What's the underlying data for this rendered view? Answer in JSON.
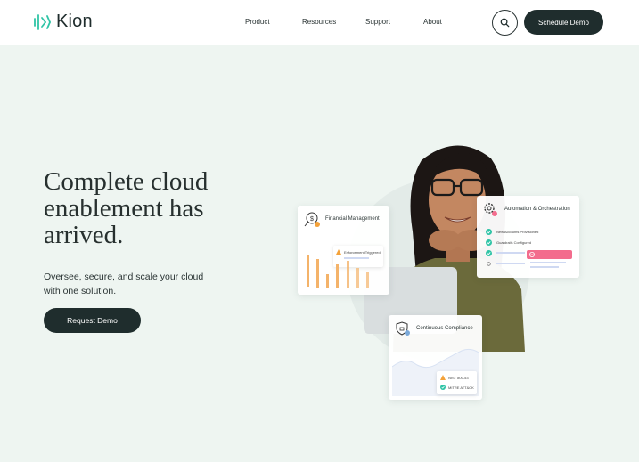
{
  "header": {
    "logo_text": "Kion",
    "nav": [
      "Product",
      "Resources",
      "Support",
      "About"
    ],
    "cta_label": "Schedule Demo"
  },
  "hero": {
    "title": "Complete cloud enablement has arrived.",
    "subtitle": "Oversee, secure, and scale your cloud with one solution.",
    "button_label": "Request Demo"
  },
  "cards": {
    "financial": {
      "title": "Financial Management",
      "alert": "Enforcement Triggered"
    },
    "automation": {
      "title": "Automation & Orchestration",
      "items": [
        "New Accounts Provisioned",
        "Guardrails Configured"
      ]
    },
    "compliance": {
      "title": "Continuous Compliance",
      "items": [
        "NIST 800-53",
        "MITRE ATT&CK"
      ]
    }
  },
  "colors": {
    "brand_teal": "#2fc4a6",
    "dark": "#1f2d2d",
    "background": "#eef5f1",
    "bar_orange": "#f4b36a",
    "alert_pink": "#f36c8d"
  },
  "icons": [
    "search-icon",
    "dollar-search-icon",
    "gear-icon",
    "shield-lock-icon",
    "warning-icon",
    "check-icon"
  ]
}
